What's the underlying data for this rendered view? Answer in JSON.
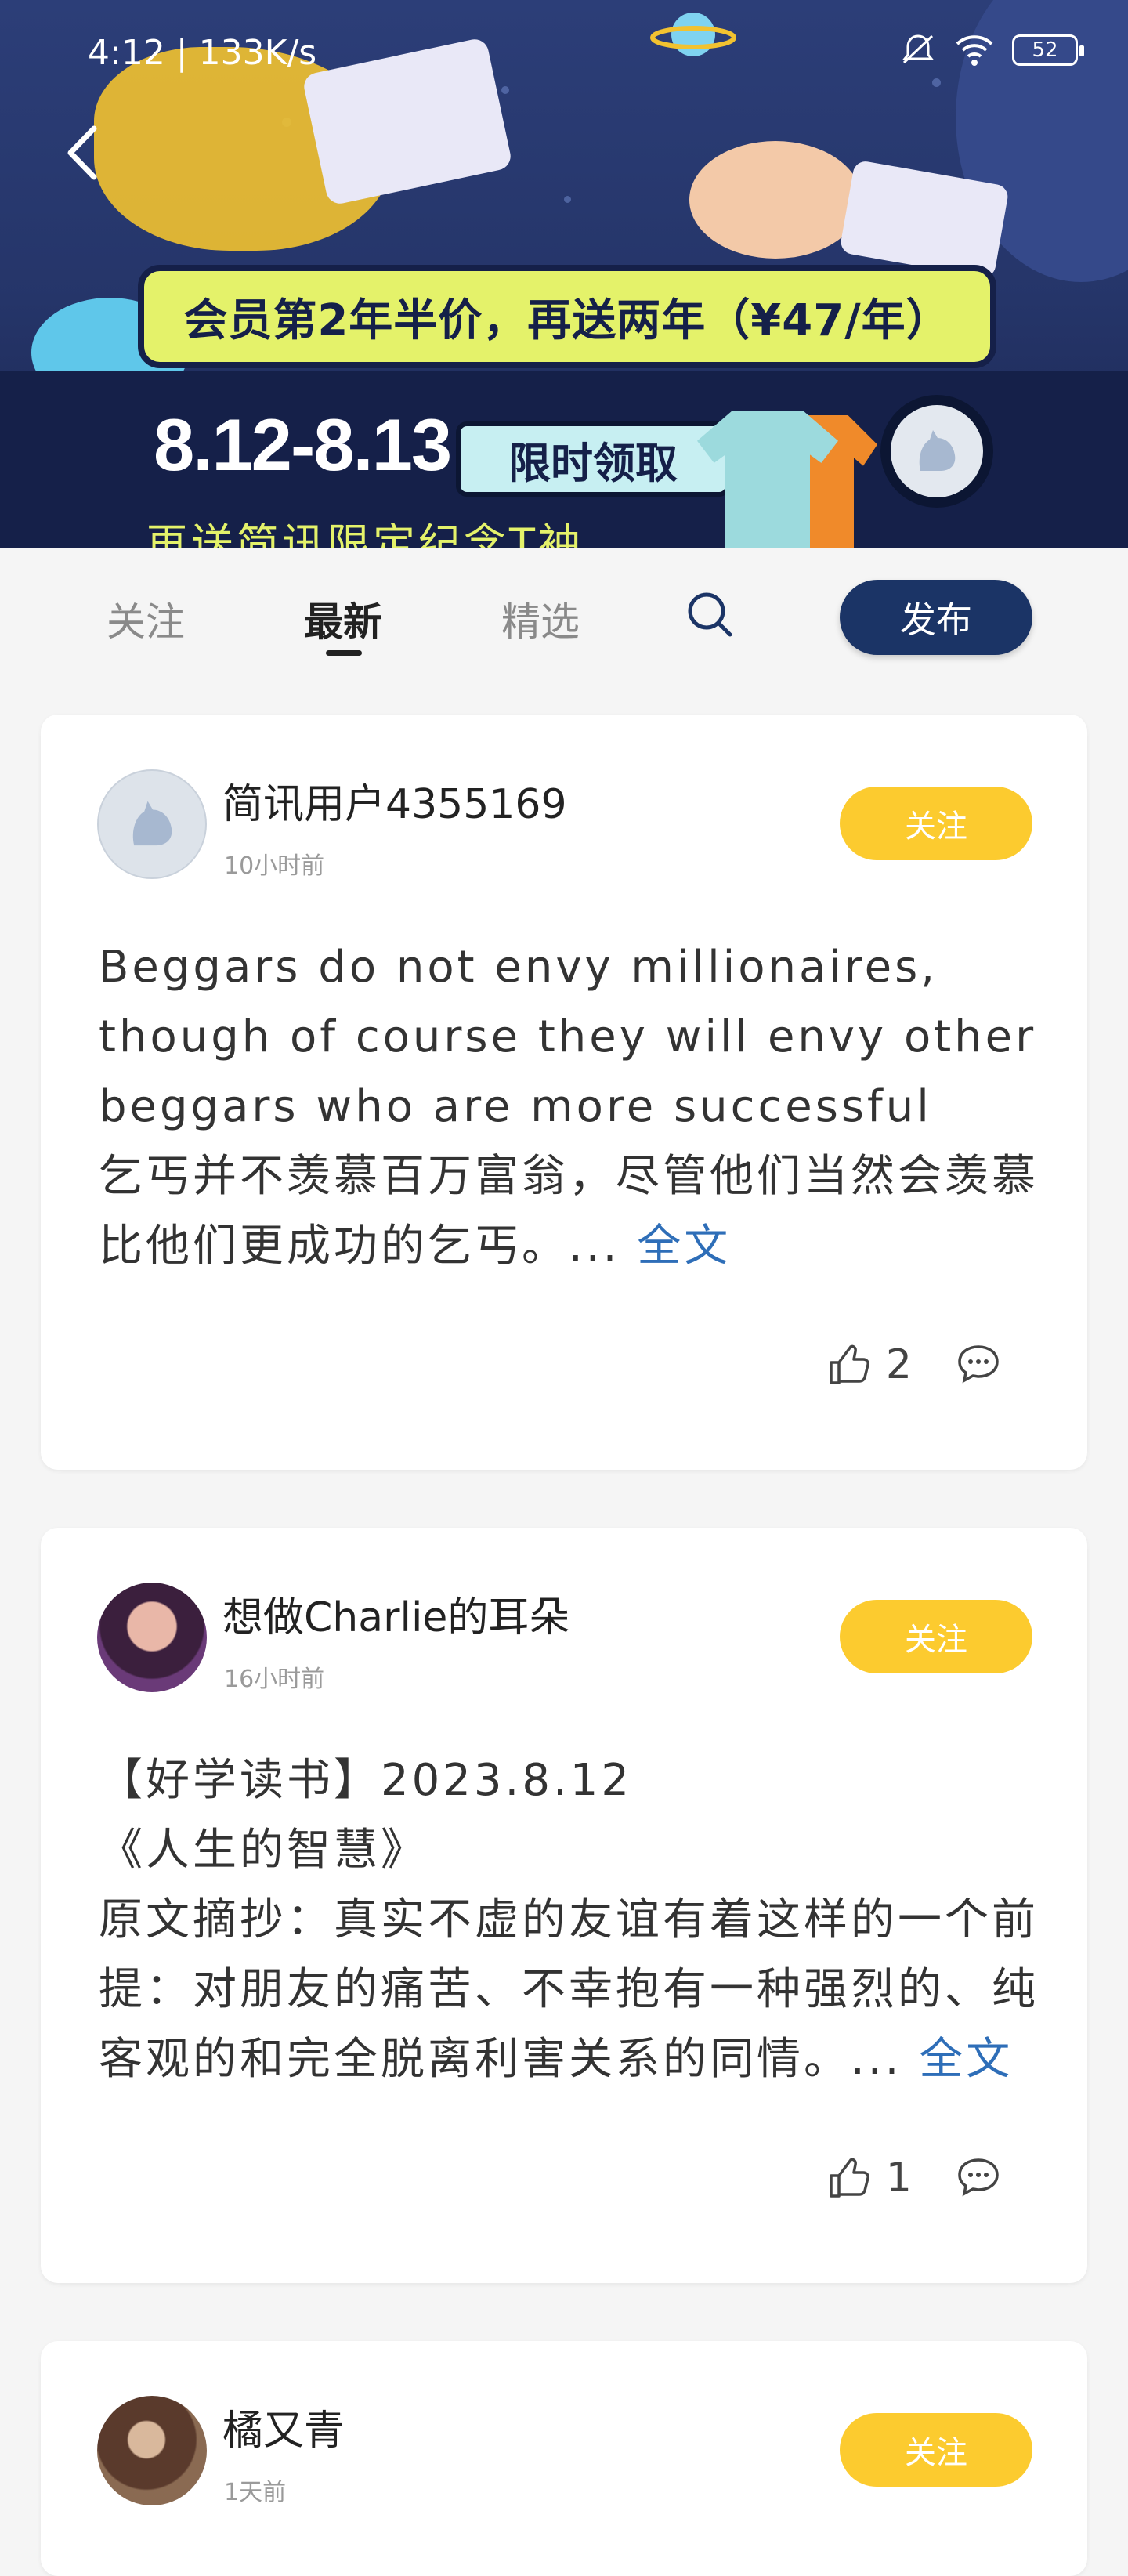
{
  "status_bar": {
    "time": "4:12 | 133K/s",
    "battery": "52"
  },
  "banner": {
    "headline": "会员第2年半价，再送两年（¥47/年）",
    "dates": "8.12-8.13",
    "tag": "限时领取",
    "subtitle": "再送简讯限定纪念T袖"
  },
  "tabs": [
    {
      "label": "关注",
      "active": false
    },
    {
      "label": "最新",
      "active": true
    },
    {
      "label": "精选",
      "active": false
    }
  ],
  "publish_label": "发布",
  "posts": [
    {
      "username": "简讯用户4355169",
      "time": "10小时前",
      "follow_label": "关注",
      "lines": [
        "Beggars do not envy millionaires,",
        "though of course they will envy other",
        "beggars who are more successful",
        "乞丐并不羡慕百万富翁，尽管他们当然会羡慕",
        "比他们更成功的乞丐。..."
      ],
      "full_text_label": "全文",
      "likes": "2"
    },
    {
      "username": "想做Charlie的耳朵",
      "time": "16小时前",
      "follow_label": "关注",
      "lines": [
        "【好学读书】2023.8.12",
        "《人生的智慧》",
        "原文摘抄：真实不虚的友谊有着这样的一个前",
        "提：对朋友的痛苦、不幸抱有一种强烈的、纯",
        "客观的和完全脱离利害关系的同情。..."
      ],
      "full_text_label": "全文",
      "likes": "1"
    },
    {
      "username": "橘又青",
      "time": "1天前",
      "follow_label": "关注"
    }
  ],
  "colors": {
    "accent_navy": "#1b3466",
    "follow_yellow": "#fccb2f",
    "link_blue": "#2e6eb8"
  }
}
